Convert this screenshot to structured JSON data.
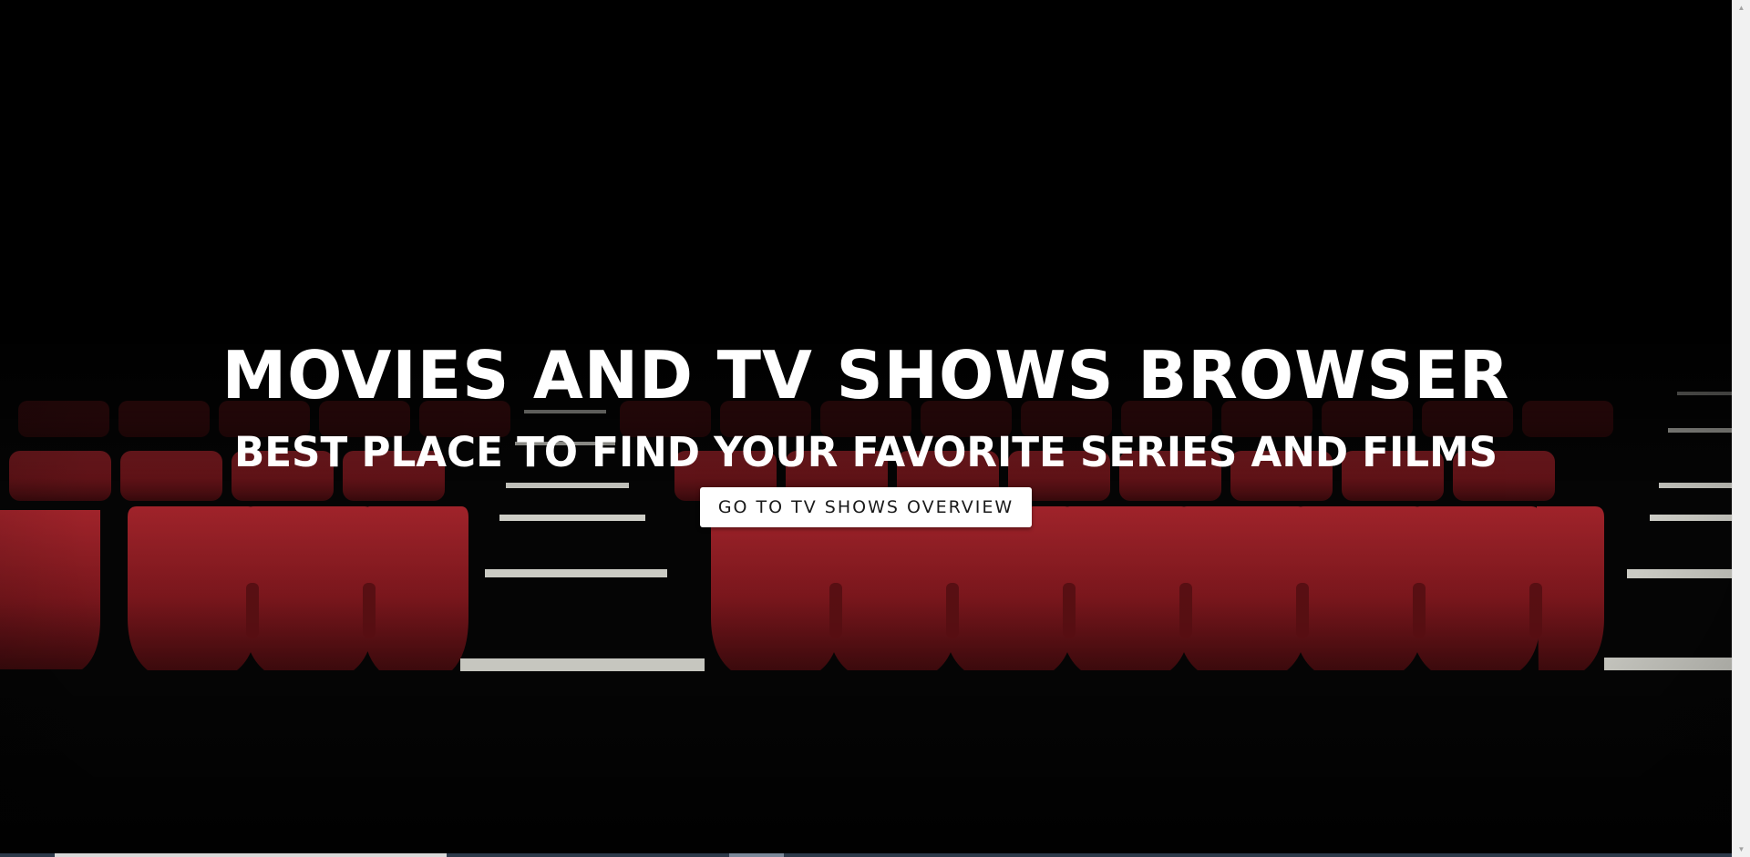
{
  "hero": {
    "title": "MOVIES AND TV SHOWS BROWSER",
    "subtitle": "BEST PLACE TO FIND YOUR FAVORITE SERIES AND FILMS",
    "cta_label": "GO TO TV SHOWS OVERVIEW",
    "background": "cinema-seats-image"
  },
  "colors": {
    "background": "#000000",
    "seat_red": "#8b1a1f",
    "text": "#ffffff",
    "button_bg": "#ffffff",
    "button_text": "#1a1a1a"
  },
  "scrollbar": {
    "up_icon": "chevron-up-icon",
    "down_icon": "chevron-down-icon"
  }
}
